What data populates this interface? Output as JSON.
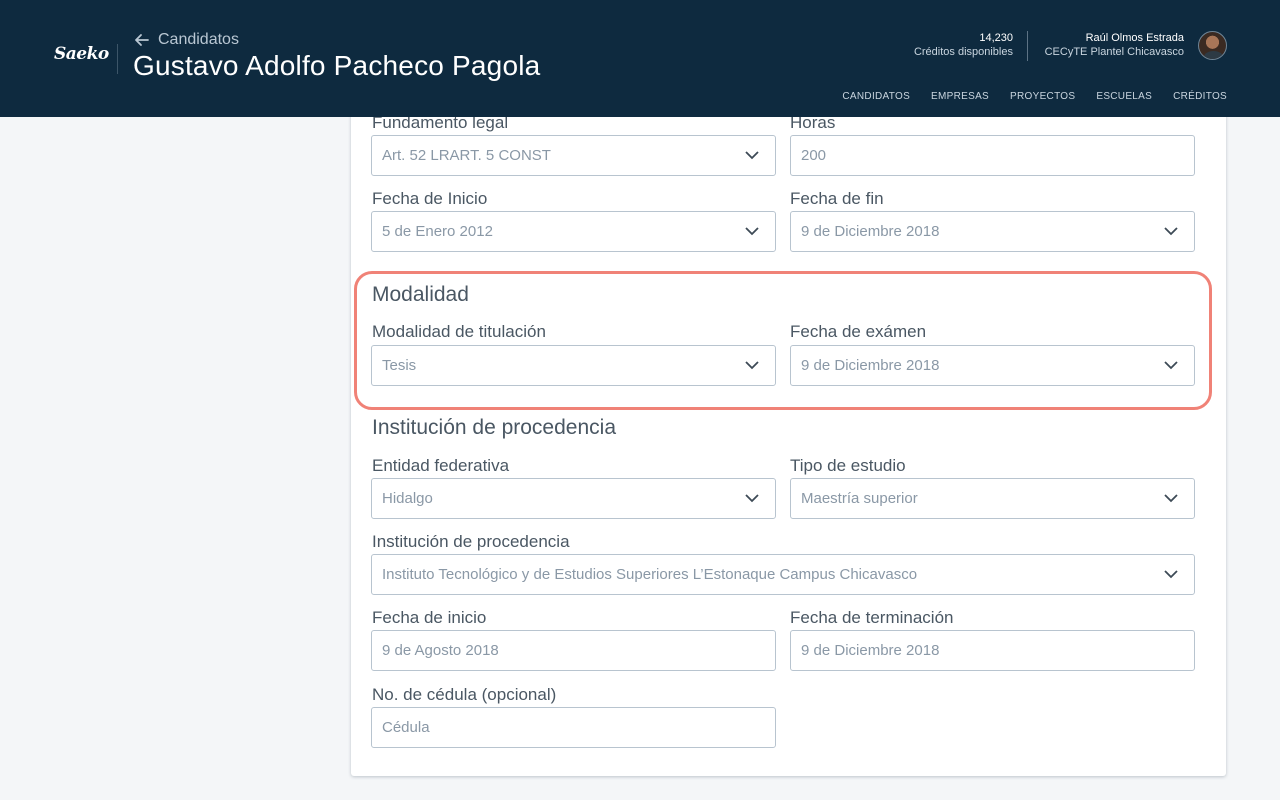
{
  "header": {
    "logo": "Saeko",
    "back_label": "Candidatos",
    "title": "Gustavo Adolfo Pacheco Pagola",
    "credits_value": "14,230",
    "credits_label": "Créditos disponibles",
    "user_name": "Raúl Olmos Estrada",
    "user_org": "CECyTE Plantel Chicavasco",
    "nav": [
      "CANDIDATOS",
      "EMPRESAS",
      "PROYECTOS",
      "ESCUELAS",
      "CRÉDITOS"
    ],
    "bg_color": "#0e2a3f"
  },
  "form": {
    "fundamento": {
      "label": "Fundamento legal",
      "value": "Art. 52 LRART. 5 CONST"
    },
    "horas": {
      "label": "Horas",
      "value": "200"
    },
    "fecha_inicio": {
      "label": "Fecha de Inicio",
      "value": "5 de Enero 2012"
    },
    "fecha_fin": {
      "label": "Fecha de fin",
      "value": "9 de Diciembre 2018"
    },
    "modalidad": {
      "title": "Modalidad",
      "titulacion": {
        "label": "Modalidad de titulación",
        "value": "Tesis"
      },
      "fecha_examen": {
        "label": "Fecha de exámen",
        "value": "9 de Diciembre 2018"
      }
    },
    "institucion": {
      "title": "Institución de procedencia",
      "entidad": {
        "label": "Entidad federativa",
        "value": "Hidalgo"
      },
      "tipo": {
        "label": "Tipo de estudio",
        "value": "Maestría superior"
      },
      "institucion": {
        "label": "Institución de procedencia",
        "value": "Instituto Tecnológico y de Estudios Superiores L’Estonaque Campus Chicavasco"
      },
      "fecha_inicio": {
        "label": "Fecha de inicio",
        "value": "9 de Agosto 2018"
      },
      "fecha_termino": {
        "label": "Fecha de terminación",
        "value": "9 de Diciembre 2018"
      },
      "cedula": {
        "label": "No. de cédula (opcional)",
        "placeholder": "Cédula"
      }
    }
  },
  "highlight_color": "#f08277"
}
